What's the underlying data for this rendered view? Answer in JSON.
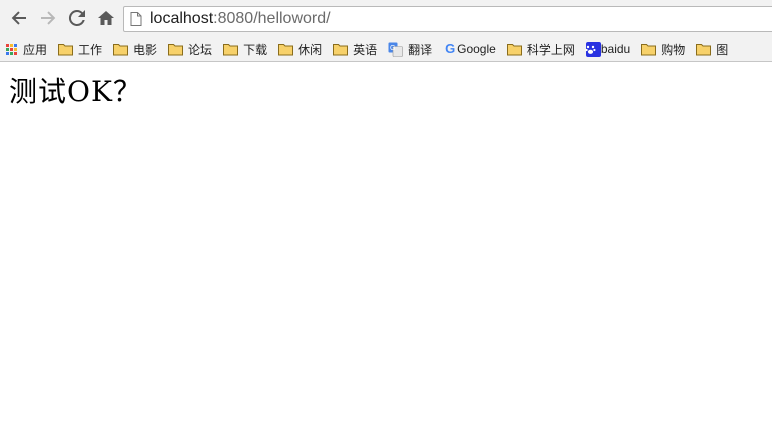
{
  "browser": {
    "url_host": "localhost",
    "url_rest": ":8080/helloword/"
  },
  "nav_icons": [
    "back-arrow-icon",
    "forward-arrow-icon",
    "reload-icon",
    "home-icon"
  ],
  "bookmarks": [
    {
      "label": "应用",
      "icon": "apps-grid-icon"
    },
    {
      "label": "工作",
      "icon": "folder-icon"
    },
    {
      "label": "电影",
      "icon": "folder-icon"
    },
    {
      "label": "论坛",
      "icon": "folder-icon"
    },
    {
      "label": "下载",
      "icon": "folder-icon"
    },
    {
      "label": "休闲",
      "icon": "folder-icon"
    },
    {
      "label": "英语",
      "icon": "folder-icon"
    },
    {
      "label": "翻译",
      "icon": "translate-icon"
    },
    {
      "label": "Google",
      "icon": "google-icon"
    },
    {
      "label": "科学上网",
      "icon": "folder-icon"
    },
    {
      "label": "baidu",
      "icon": "baidu-paw-icon"
    },
    {
      "label": "购物",
      "icon": "folder-icon"
    },
    {
      "label": "图",
      "icon": "folder-icon"
    }
  ],
  "page": {
    "heading": "测试OK？"
  },
  "colors": {
    "toolbar_bg": "#f2f2f2",
    "folder_fill": "#f7d16a",
    "baidu_blue": "#2932e1",
    "google_blue": "#4285f4"
  }
}
